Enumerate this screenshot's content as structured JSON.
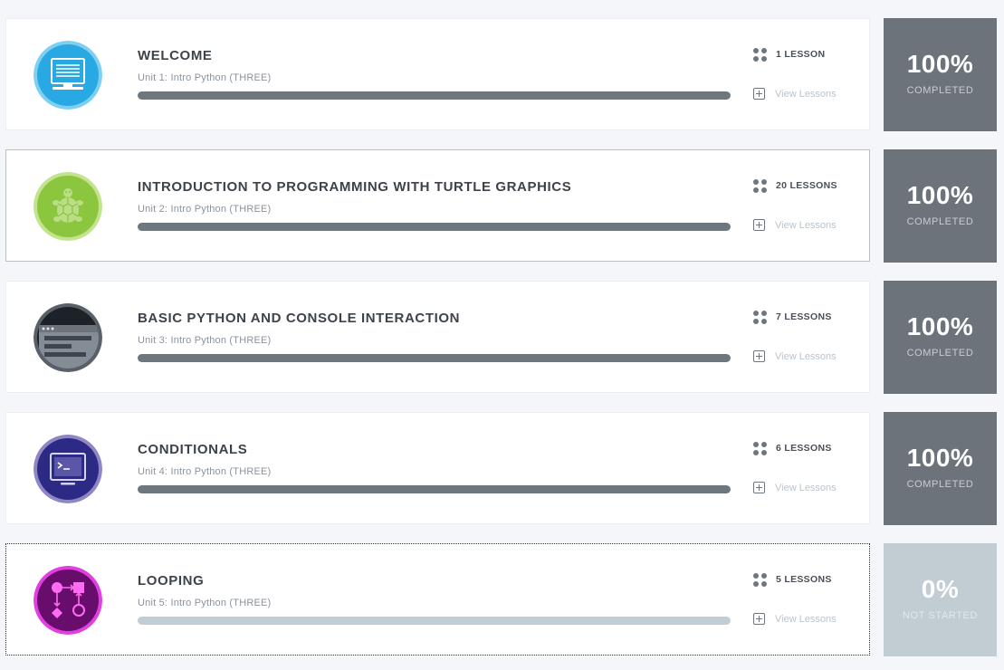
{
  "colors": {
    "page_background": "#f4f6f9",
    "progress_fill": "#6e767e",
    "progress_track": "#c1cdd4",
    "completed_tile": "#6d737b",
    "not_started_tile": "#c1ccd3"
  },
  "units": [
    {
      "title": "WELCOME",
      "subtitle": "Unit 1: Intro Python (THREE)",
      "lessons_label": "1 LESSON",
      "view_lessons_label": "View Lessons",
      "progress_percent": 100,
      "status_percent": "100%",
      "status_label": "COMPLETED",
      "icon": "monitor-icon"
    },
    {
      "title": "INTRODUCTION TO PROGRAMMING WITH TURTLE GRAPHICS",
      "subtitle": "Unit 2: Intro Python (THREE)",
      "lessons_label": "20 LESSONS",
      "view_lessons_label": "View Lessons",
      "progress_percent": 100,
      "status_percent": "100%",
      "status_label": "COMPLETED",
      "icon": "turtle-icon"
    },
    {
      "title": "BASIC PYTHON AND CONSOLE INTERACTION",
      "subtitle": "Unit 3: Intro Python (THREE)",
      "lessons_label": "7 LESSONS",
      "view_lessons_label": "View Lessons",
      "progress_percent": 100,
      "status_percent": "100%",
      "status_label": "COMPLETED",
      "icon": "console-window-icon"
    },
    {
      "title": "CONDITIONALS",
      "subtitle": "Unit 4: Intro Python (THREE)",
      "lessons_label": "6 LESSONS",
      "view_lessons_label": "View Lessons",
      "progress_percent": 100,
      "status_percent": "100%",
      "status_label": "COMPLETED",
      "icon": "terminal-prompt-icon"
    },
    {
      "title": "LOOPING",
      "subtitle": "Unit 5: Intro Python (THREE)",
      "lessons_label": "5 LESSONS",
      "view_lessons_label": "View Lessons",
      "progress_percent": 0,
      "status_percent": "0%",
      "status_label": "NOT STARTED",
      "icon": "flowchart-icon"
    }
  ]
}
